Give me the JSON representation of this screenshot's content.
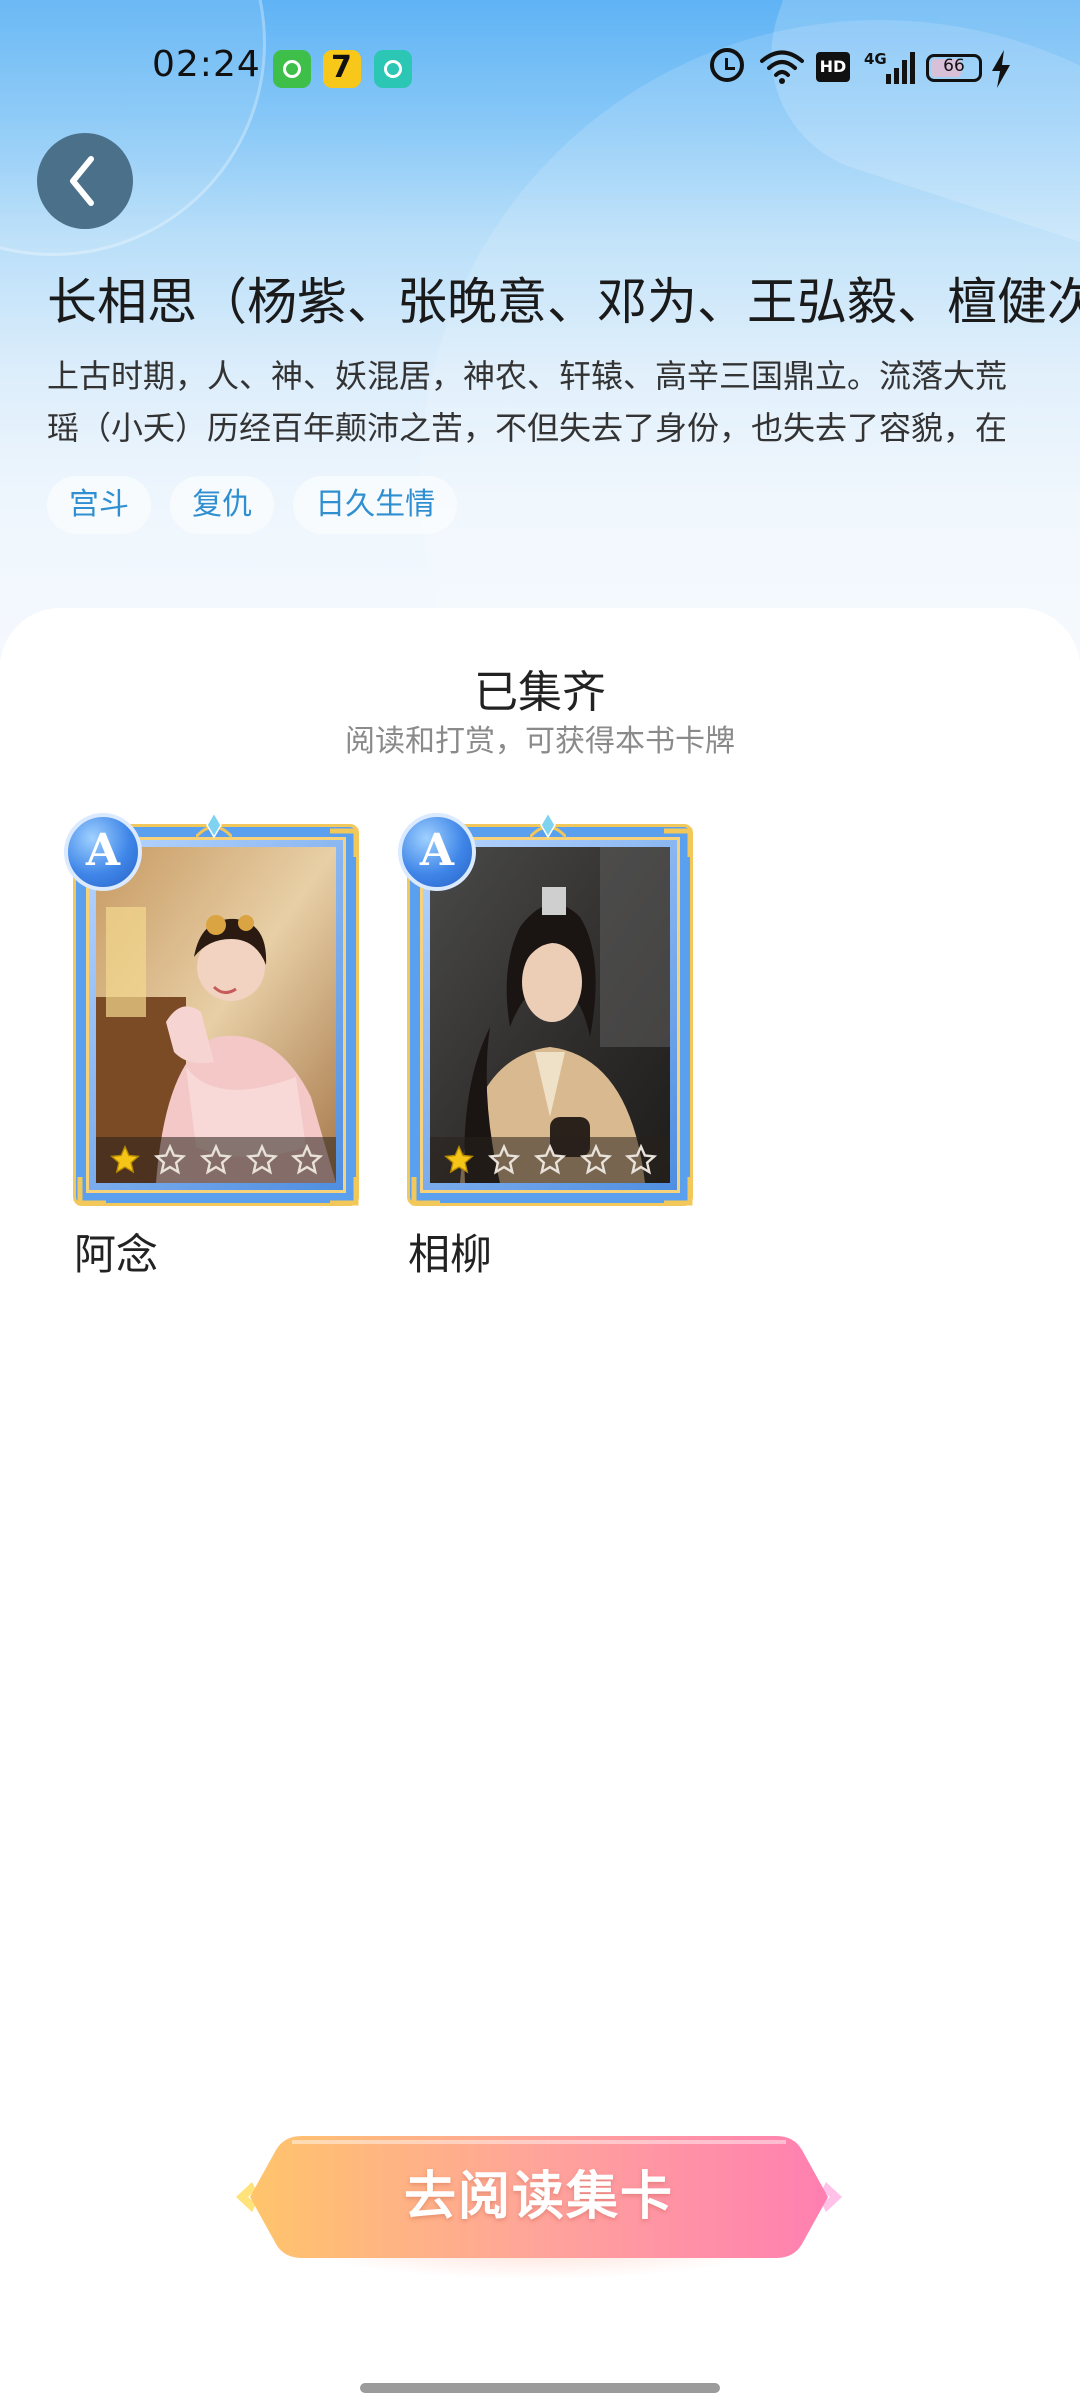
{
  "status_bar": {
    "time": "02:24",
    "network": "4G",
    "hd": "HD",
    "battery": "66"
  },
  "book": {
    "title": "长相思（杨紫、张晚意、邓为、王弘毅、檀健次",
    "description": [
      "上古时期，人、神、妖混居，神农、轩辕、高辛三国鼎立。流落大荒",
      "瑶（小夭）历经百年颠沛之苦，不但失去了身份，也失去了容貌，在"
    ],
    "tags": [
      "宫斗",
      "复仇",
      "日久生情"
    ]
  },
  "collection": {
    "title": "已集齐",
    "subtitle": "阅读和打赏，可获得本书卡牌",
    "cards": [
      {
        "name": "阿念",
        "rarity": "A",
        "stars_filled": 1,
        "stars_total": 5
      },
      {
        "name": "相柳",
        "rarity": "A",
        "stars_filled": 1,
        "stars_total": 5
      }
    ]
  },
  "cta": {
    "label": "去阅读集卡"
  },
  "colors": {
    "accent": "#2f8fd0",
    "card_border": "#5aa0ef",
    "star_gold": "#f5c518",
    "cta_start": "#ffc46b",
    "cta_end": "#ff7fb1"
  },
  "icons": {
    "back": "chevron-left-icon",
    "alarm": "alarm-icon",
    "wifi": "wifi-icon",
    "signal": "signal-icon",
    "battery": "battery-icon",
    "charging": "bolt-icon",
    "star": "star-icon"
  }
}
